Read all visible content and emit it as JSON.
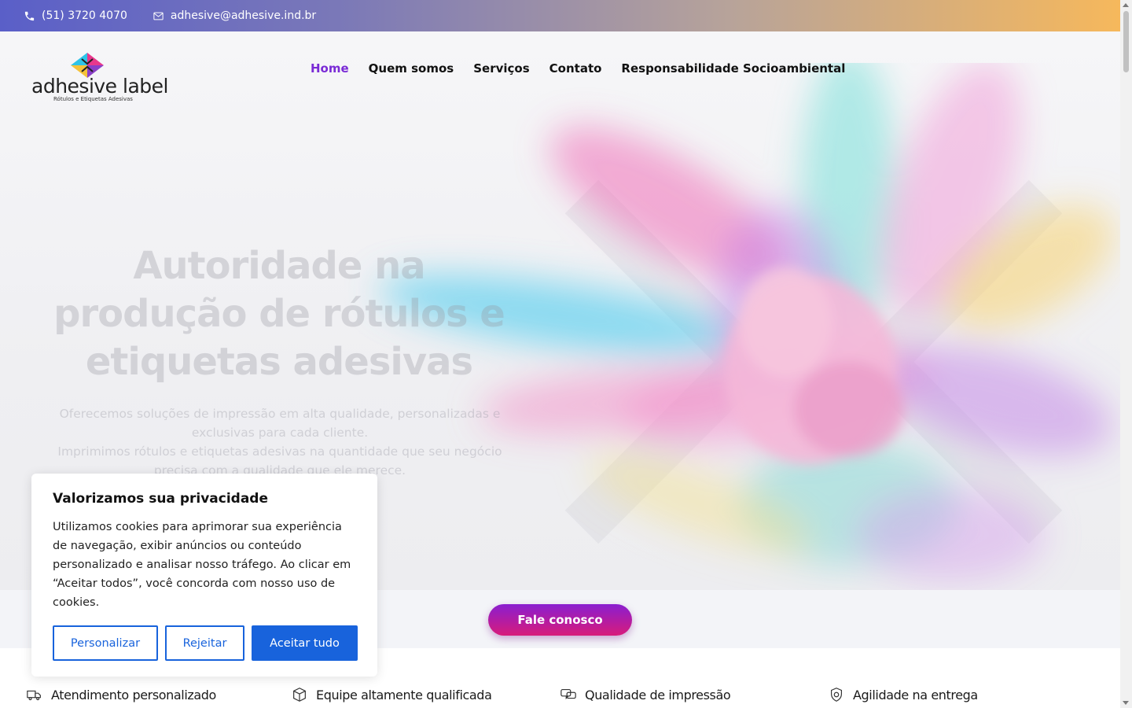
{
  "topbar": {
    "phone": "(51) 3720 4070",
    "email": "adhesive@adhesive.ind.br"
  },
  "logo": {
    "wordmark": "adhesive label",
    "tagline": "Rótulos e Etiquetas Adesivas"
  },
  "nav": {
    "items": [
      {
        "label": "Home",
        "active": true
      },
      {
        "label": "Quem somos",
        "active": false
      },
      {
        "label": "Serviços",
        "active": false
      },
      {
        "label": "Contato",
        "active": false
      },
      {
        "label": "Responsabilidade Socioambiental",
        "active": false
      }
    ]
  },
  "hero": {
    "title": "Autoridade na produção de rótulos e etiquetas adesivas",
    "subtitle_line1": "Oferecemos soluções de impressão em alta qualidade, personalizadas e exclusivas para cada cliente.",
    "subtitle_line2": "Imprimimos rótulos e etiquetas adesivas na quantidade que seu negócio precisa com a qualidade que ele merece.",
    "cta_label": "Fale conosco"
  },
  "features": [
    {
      "label": "Atendimento personalizado",
      "icon": "truck-icon"
    },
    {
      "label": "Equipe altamente qualificada",
      "icon": "box-icon"
    },
    {
      "label": "Qualidade de impressão",
      "icon": "chat-icon"
    },
    {
      "label": "Agilidade na entrega",
      "icon": "shield-icon"
    }
  ],
  "cookie": {
    "title": "Valorizamos sua privacidade",
    "text": "Utilizamos cookies para aprimorar sua experiência de navegação, exibir anúncios ou conteúdo personalizado e analisar nosso tráfego. Ao clicar em “Aceitar todos”, você concorda com nosso uso de cookies.",
    "customize_label": "Personalizar",
    "reject_label": "Rejeitar",
    "accept_label": "Aceitar tudo"
  },
  "colors": {
    "accent": "#7a2bd6",
    "cookie_button": "#1863dc",
    "cta_start": "#8a1ed0",
    "cta_end": "#d81b7a"
  }
}
